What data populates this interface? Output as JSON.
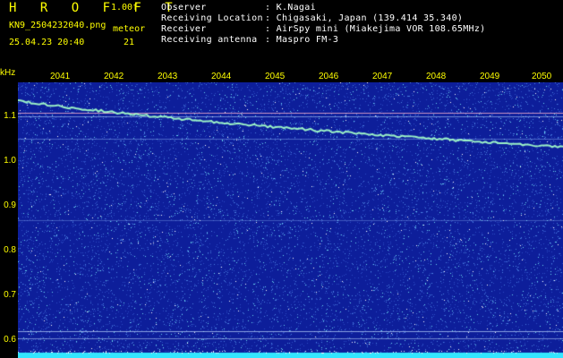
{
  "header": {
    "app_title": "H R O F F T",
    "version": "1.00f",
    "filename": "KN9_2504232040.png",
    "datetime": "25.04.23 20:40",
    "meteor_label": "meteor",
    "meteor_count": "21"
  },
  "info": [
    {
      "key": "Observer",
      "value": ": K.Nagai"
    },
    {
      "key": "Receiving Location",
      "value": ": Chigasaki, Japan (139.414 35.340)"
    },
    {
      "key": "Receiver",
      "value": ": AirSpy mini (Miakejima VOR 108.65MHz)"
    },
    {
      "key": "Receiving antenna",
      "value": ": Maspro FM-3"
    }
  ],
  "axes": {
    "y_unit": "kHz",
    "y_labels": [
      "1.1",
      "1.0",
      "0.9",
      "0.8",
      "0.7",
      "0.6"
    ],
    "x_labels": [
      "2041",
      "2042",
      "2043",
      "2044",
      "2045",
      "2046",
      "2047",
      "2048",
      "2049",
      "2050"
    ]
  },
  "colors": {
    "background": "#0d1e9a",
    "noise_a": "#4a7fe0",
    "noise_b": "#6ad8f0",
    "trace": "#9bf2c6",
    "label": "#ffff00"
  }
}
